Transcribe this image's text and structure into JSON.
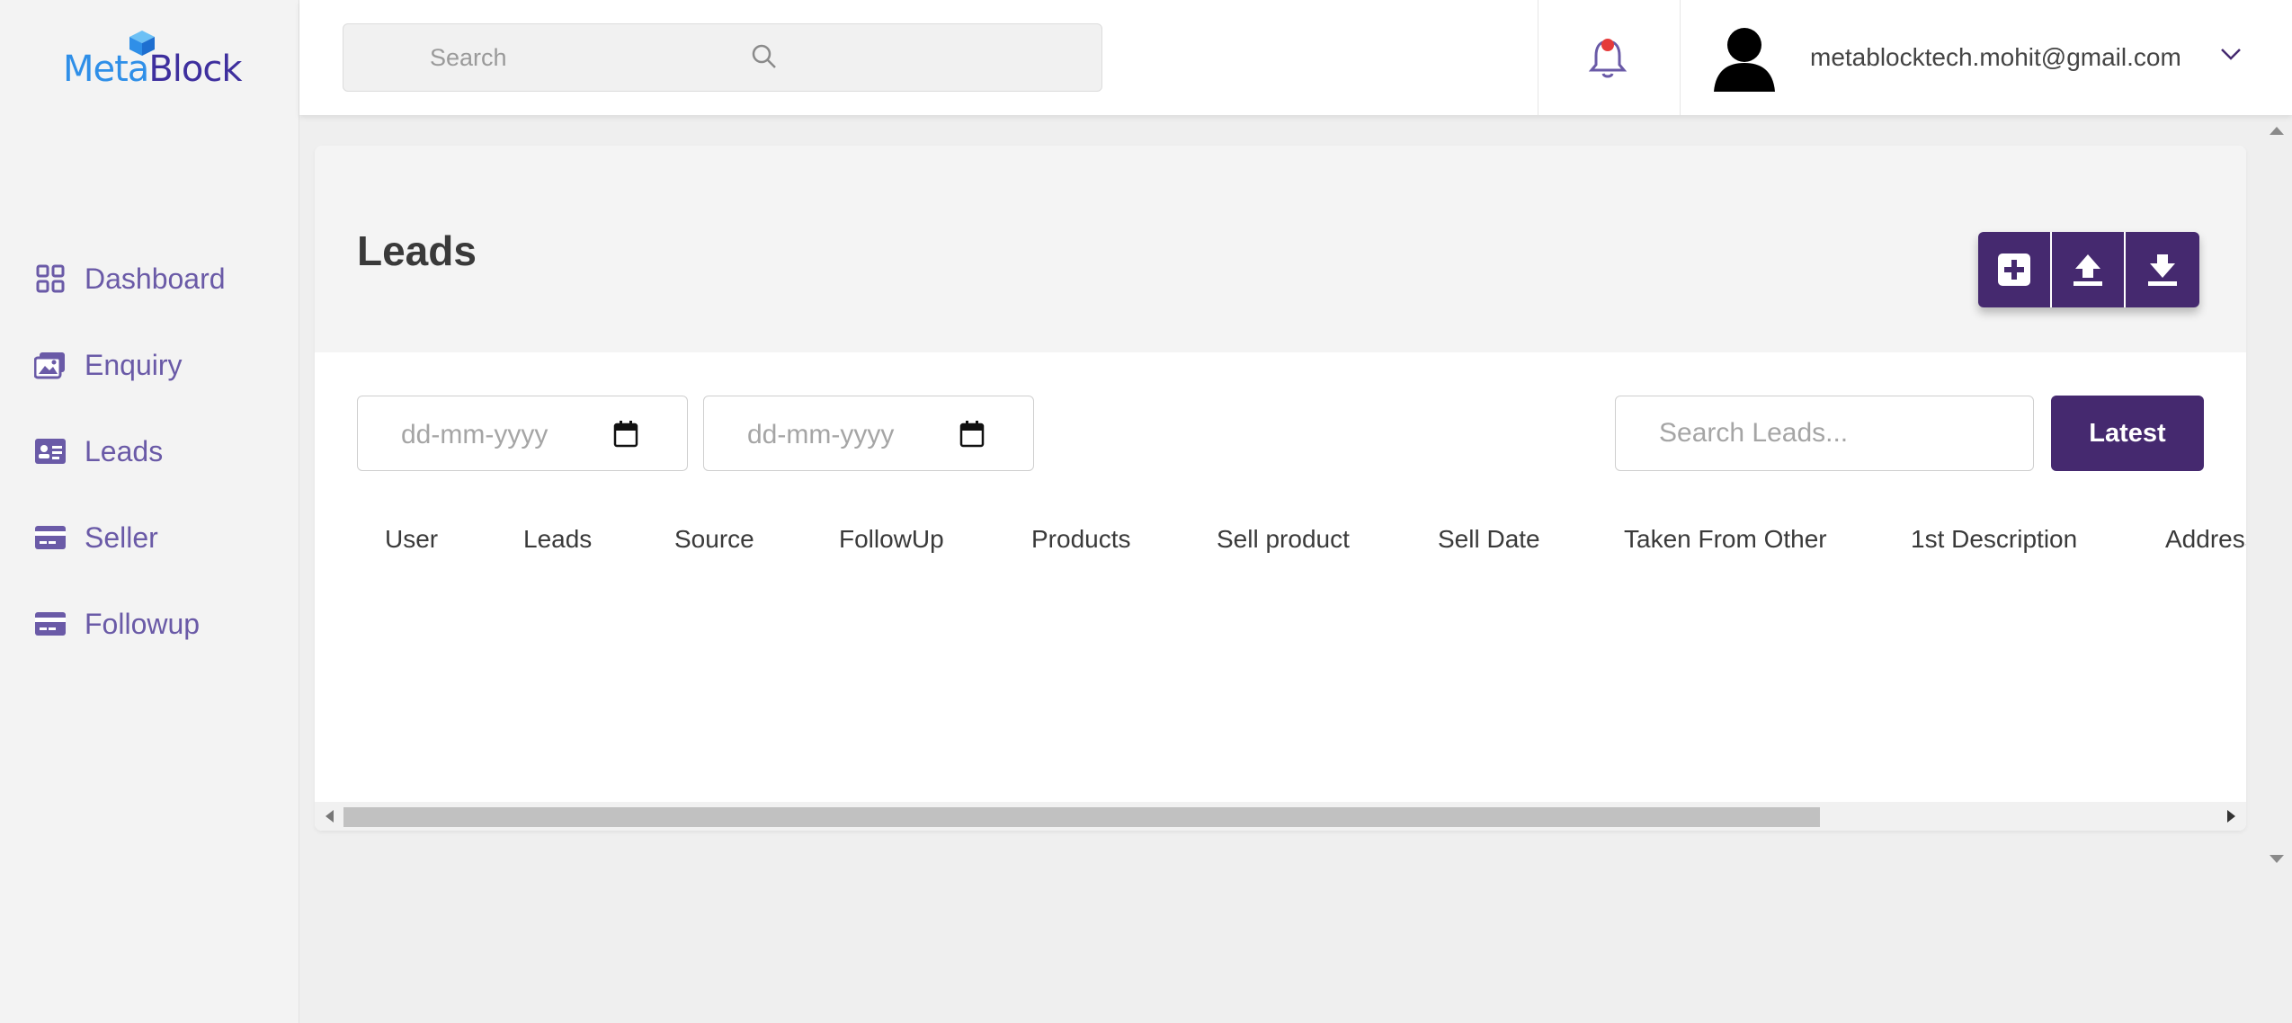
{
  "brand": {
    "part1": "Meta",
    "part2": "Block"
  },
  "sidebar": {
    "items": [
      {
        "label": "Dashboard",
        "icon": "grid-icon"
      },
      {
        "label": "Enquiry",
        "icon": "images-icon"
      },
      {
        "label": "Leads",
        "icon": "id-card-icon"
      },
      {
        "label": "Seller",
        "icon": "credit-card-icon"
      },
      {
        "label": "Followup",
        "icon": "credit-card-icon"
      }
    ]
  },
  "topbar": {
    "search_placeholder": "Search",
    "user_email": "metablocktech.mohit@gmail.com"
  },
  "page": {
    "title": "Leads",
    "date_from_placeholder": "dd-mm-yyyy",
    "date_to_placeholder": "dd-mm-yyyy",
    "search_placeholder": "Search Leads...",
    "latest_label": "Latest",
    "columns": [
      "User",
      "Leads",
      "Source",
      "FollowUp",
      "Products",
      "Sell product",
      "Sell Date",
      "Taken From Other",
      "1st Description",
      "Address"
    ]
  },
  "colors": {
    "primary": "#45296f",
    "sidebar_text": "#6a5aa7",
    "brand_blue": "#2f8fe8",
    "brand_dark": "#3e2f9e"
  }
}
